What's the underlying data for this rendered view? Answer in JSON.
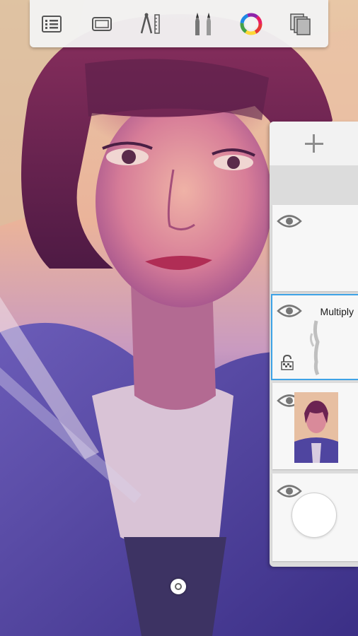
{
  "toolbar": {
    "buttons": [
      {
        "name": "layer-list-icon"
      },
      {
        "name": "canvas-frame-icon"
      },
      {
        "name": "ruler-compass-icon"
      },
      {
        "name": "brush-pens-icon"
      },
      {
        "name": "color-wheel-icon"
      },
      {
        "name": "layers-stack-icon"
      }
    ]
  },
  "layers_panel": {
    "add_button": {
      "icon": "plus-icon"
    },
    "layers": [
      {
        "visible": true,
        "blend_mode": "",
        "selected": false,
        "locked": false
      },
      {
        "visible": true,
        "blend_mode": "Multiply",
        "selected": true,
        "locked": true
      },
      {
        "visible": true,
        "blend_mode": "",
        "selected": false,
        "locked": false
      },
      {
        "visible": true,
        "blend_mode": "",
        "selected": false,
        "locked": false,
        "is_background": true
      }
    ]
  },
  "colors": {
    "selection_outline": "#3ea3e6",
    "panel_background": "#dcdcdc",
    "toolbar_background": "#f3f3f3"
  }
}
